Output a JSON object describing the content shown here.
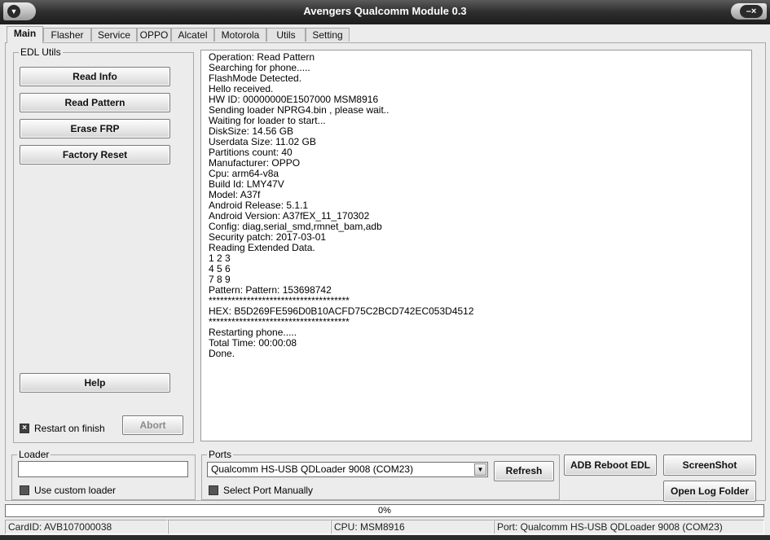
{
  "window": {
    "title": "Avengers Qualcomm Module 0.3"
  },
  "tabs": [
    {
      "label": "Main",
      "active": true
    },
    {
      "label": "Flasher"
    },
    {
      "label": "Service"
    },
    {
      "label": "OPPO"
    },
    {
      "label": "Alcatel"
    },
    {
      "label": "Motorola"
    },
    {
      "label": "Utils"
    },
    {
      "label": "Setting"
    }
  ],
  "edl_utils": {
    "legend": "EDL Utils",
    "buttons": [
      "Read Info",
      "Read Pattern",
      "Erase FRP",
      "Factory Reset"
    ],
    "help": "Help",
    "restart_label": "Restart on finish",
    "restart_checked": true,
    "abort": "Abort"
  },
  "log": {
    "lines": [
      "Operation: Read Pattern",
      "Searching for phone.....",
      "FlashMode Detected.",
      "Hello received.",
      "HW ID: 00000000E1507000 MSM8916",
      "Sending loader NPRG4.bin , please wait..",
      "Waiting for loader to start...",
      "DiskSize: 14.56 GB",
      "Userdata Size: 11.02 GB",
      "Partitions count: 40",
      "Manufacturer: OPPO",
      "Cpu: arm64-v8a",
      "Build Id: LMY47V",
      "Model: A37f",
      "Android Release: 5.1.1",
      "Android Version: A37fEX_11_170302",
      "Config: diag,serial_smd,rmnet_bam,adb",
      "Security patch: 2017-03-01",
      "Reading Extended Data.",
      "1 2 3",
      "4 5 6",
      "7 8 9",
      "Pattern: Pattern: 153698742",
      "*************************************",
      "HEX: B5D269FE596D0B10ACFD75C2BCD742EC053D4512",
      "*************************************",
      "Restarting phone.....",
      "Total Time: 00:00:08",
      "Done."
    ]
  },
  "loader": {
    "legend": "Loader",
    "value": "",
    "use_custom_label": "Use custom loader",
    "use_custom_checked": false
  },
  "ports": {
    "legend": "Ports",
    "selected": "Qualcomm HS-USB QDLoader 9008 (COM23)",
    "refresh": "Refresh",
    "manual_label": "Select Port Manually",
    "manual_checked": false
  },
  "actions": {
    "adb_reboot_edl": "ADB Reboot EDL",
    "screenshot": "ScreenShot",
    "open_log_folder": "Open Log Folder"
  },
  "progress": {
    "value": 0,
    "label": "0%"
  },
  "status": {
    "card": "CardID: AVB107000038",
    "blank": "",
    "cpu": "CPU: MSM8916",
    "port": "Port: Qualcomm HS-USB QDLoader 9008 (COM23)"
  }
}
